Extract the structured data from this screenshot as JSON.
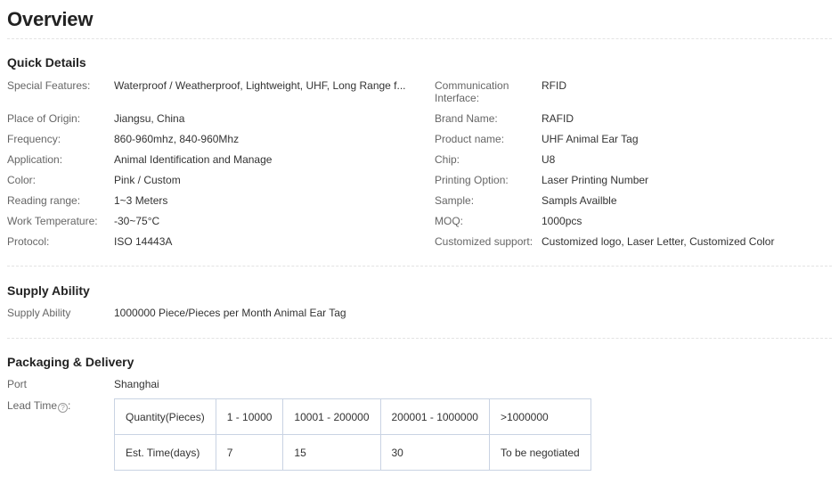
{
  "page_title": "Overview",
  "quick_details": {
    "title": "Quick Details",
    "left": [
      {
        "label": "Special Features:",
        "value": "Waterproof / Weatherproof, Lightweight, UHF, Long Range f..."
      },
      {
        "label": "Place of Origin:",
        "value": "Jiangsu, China"
      },
      {
        "label": "Frequency:",
        "value": "860-960mhz, 840-960Mhz"
      },
      {
        "label": "Application:",
        "value": "Animal Identification and Manage"
      },
      {
        "label": "Color:",
        "value": "Pink / Custom"
      },
      {
        "label": "Reading range:",
        "value": "1~3 Meters"
      },
      {
        "label": "Work Temperature:",
        "value": "-30~75°C"
      },
      {
        "label": "Protocol:",
        "value": "ISO 14443A"
      }
    ],
    "right": [
      {
        "label_line1": "Communication",
        "label_line2": "Interface:",
        "value": "RFID"
      },
      {
        "label": "Brand Name:",
        "value": "RAFID"
      },
      {
        "label": "Product name:",
        "value": "UHF Animal Ear Tag"
      },
      {
        "label": "Chip:",
        "value": "U8"
      },
      {
        "label": "Printing Option:",
        "value": "Laser Printing Number"
      },
      {
        "label": "Sample:",
        "value": "Sampls Availble"
      },
      {
        "label": "MOQ:",
        "value": "1000pcs"
      },
      {
        "label": "Customized support:",
        "value": "Customized logo, Laser Letter, Customized Color"
      }
    ]
  },
  "supply_ability": {
    "title": "Supply Ability",
    "label": "Supply Ability",
    "value": "1000000 Piece/Pieces per Month Animal Ear Tag"
  },
  "packaging": {
    "title": "Packaging & Delivery",
    "port_label": "Port",
    "port_value": "Shanghai",
    "lead_time_label": "Lead Time",
    "help_icon_glyph": "?",
    "lead_table": {
      "row1": [
        "Quantity(Pieces)",
        "1 - 10000",
        "10001 - 200000",
        "200001 - 1000000",
        ">1000000"
      ],
      "row2": [
        "Est. Time(days)",
        "7",
        "15",
        "30",
        "To be negotiated"
      ]
    }
  }
}
